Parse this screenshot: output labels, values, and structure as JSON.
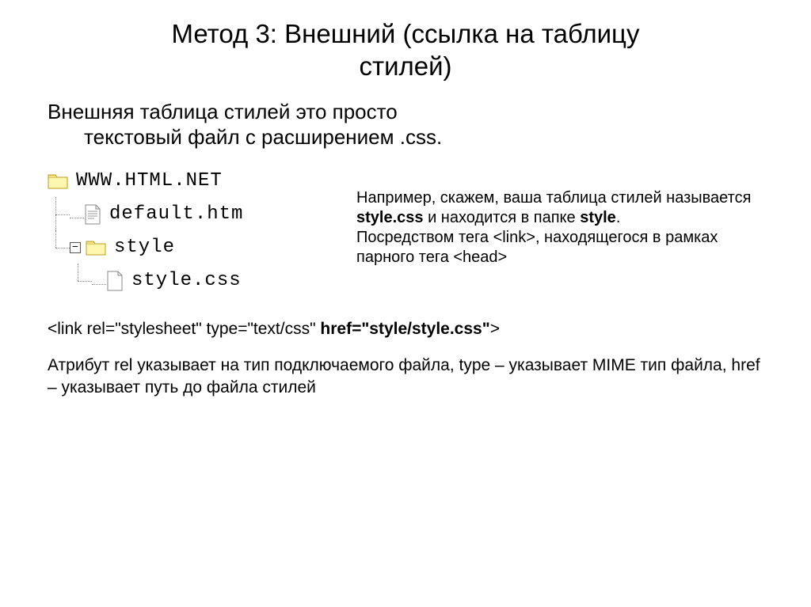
{
  "title_line1": "Метод 3: Внешний (ссылка на таблицу",
  "title_line2": "стилей)",
  "intro_line1": "Внешняя таблица стилей это просто",
  "intro_line2": "текстовый файл с расширением .css.",
  "tree": {
    "root": "WWW.HTML.NET",
    "file1": "default.htm",
    "folder2": "style",
    "file2": "style.css",
    "expander": "−"
  },
  "explain_pre": "Например, скажем, ваша таблица стилей называется ",
  "explain_b1": "style.css",
  "explain_mid1": " и находится в папке ",
  "explain_b2": "style",
  "explain_mid2": ".",
  "explain_line2a": "Посредством тега ",
  "tag_link": "<link>",
  "explain_line2b": ", находящегося в рамках парного тега ",
  "tag_head": "<head>",
  "link_code_plain1": "<link rel=\"stylesheet\" type=\"text/css\" ",
  "link_code_bold": "href=\"style/style.css\"",
  "link_code_plain2": ">",
  "footer_text": "Атрибут rel указывает на тип подключаемого файла, type – указывает MIME тип файла, href – указывает путь до файла стилей"
}
